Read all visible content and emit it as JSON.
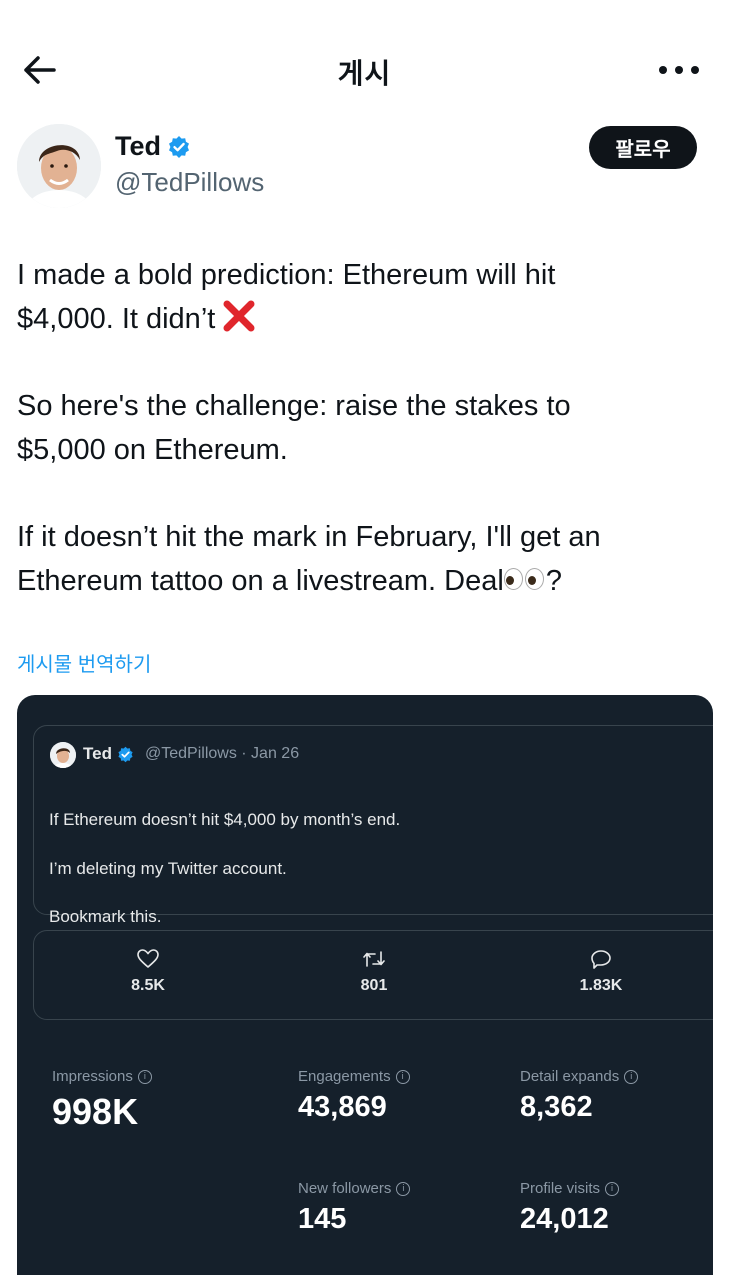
{
  "header": {
    "title": "게시",
    "back_icon": "arrow-left-icon",
    "more_icon": "more-horizontal-icon"
  },
  "author": {
    "name": "Ted",
    "handle": "@TedPillows",
    "verified": true,
    "follow_label": "팔로우"
  },
  "tweet": {
    "line1": "I made a bold prediction: Ethereum will hit",
    "line2": "$4,000. It didn’t",
    "line3": "So here's the challenge: raise the stakes to",
    "line4": "$5,000 on Ethereum.",
    "line5": "If it doesn’t hit the mark in February, I'll get an",
    "line6": "Ethereum tattoo on a livestream. Deal",
    "line6_end": "?",
    "translate_label": "게시물 번역하기"
  },
  "embedded": {
    "quote": {
      "name": "Ted",
      "meta": "@TedPillows · Jan 26",
      "line1": "If Ethereum doesn’t hit $4,000 by month’s end.",
      "line2": "I’m deleting my Twitter account.",
      "line3": "Bookmark this."
    },
    "stats": {
      "likes": "8.5K",
      "reposts": "801",
      "replies": "1.83K"
    },
    "metrics": {
      "impressions_label": "Impressions",
      "impressions": "998K",
      "engagements_label": "Engagements",
      "engagements": "43,869",
      "detail_label": "Detail expands",
      "detail": "8,362",
      "followers_label": "New followers",
      "followers": "145",
      "visits_label": "Profile visits",
      "visits": "24,012"
    }
  },
  "colors": {
    "link": "#1d9bf0",
    "verified": "#1d9bf0",
    "dark_bg": "#15202b",
    "x_mark": "#e0262c"
  }
}
